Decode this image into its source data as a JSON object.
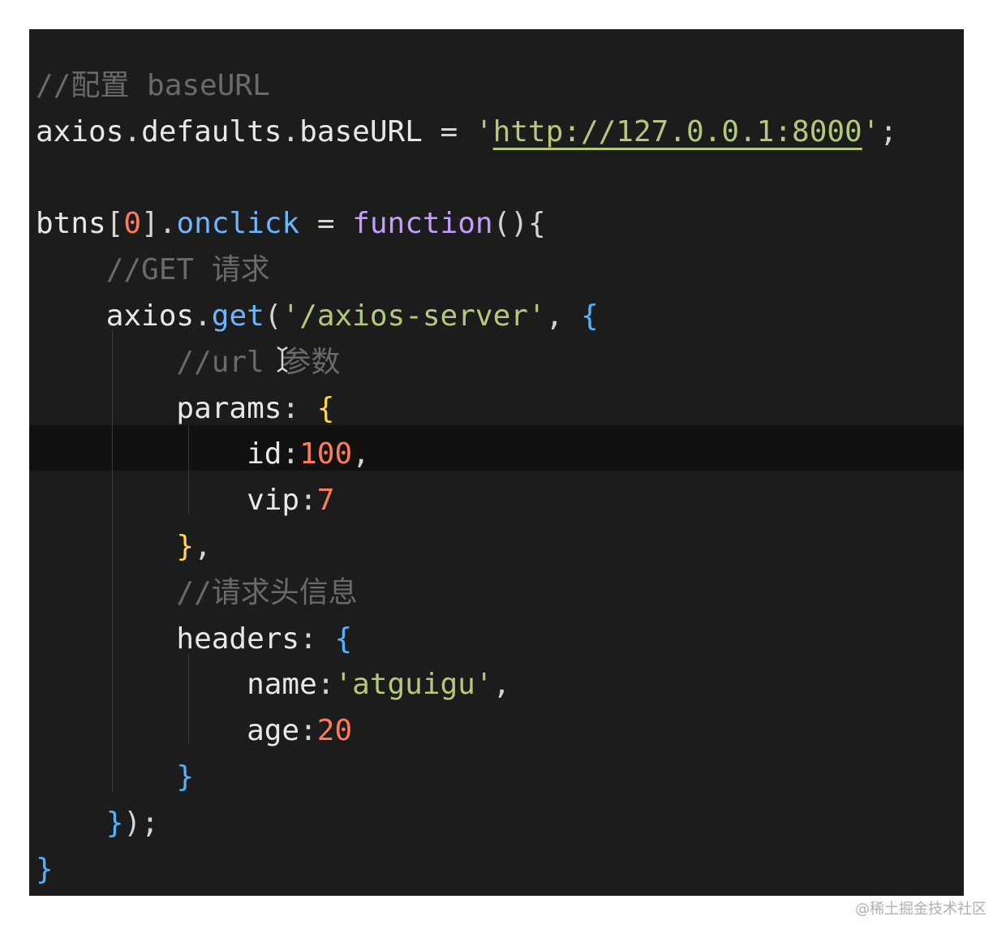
{
  "editor": {
    "lines": [
      {
        "tokens": [
          {
            "cls": "comment",
            "text": "//配置 baseURL"
          }
        ]
      },
      {
        "tokens": [
          {
            "cls": "plain",
            "text": "axios"
          },
          {
            "cls": "punct",
            "text": "."
          },
          {
            "cls": "prop",
            "text": "defaults"
          },
          {
            "cls": "punct",
            "text": "."
          },
          {
            "cls": "prop",
            "text": "baseURL"
          },
          {
            "cls": "op",
            "text": " = "
          },
          {
            "cls": "str",
            "text": "'"
          },
          {
            "cls": "url",
            "text": "http://127.0.0.1:8000"
          },
          {
            "cls": "str",
            "text": "'"
          },
          {
            "cls": "punct",
            "text": ";"
          }
        ]
      },
      {
        "tokens": []
      },
      {
        "tokens": [
          {
            "cls": "plain",
            "text": "btns"
          },
          {
            "cls": "punct",
            "text": "["
          },
          {
            "cls": "num",
            "text": "0"
          },
          {
            "cls": "punct",
            "text": "]."
          },
          {
            "cls": "method",
            "text": "onclick"
          },
          {
            "cls": "op",
            "text": " = "
          },
          {
            "cls": "kw",
            "text": "function"
          },
          {
            "cls": "punct",
            "text": "()"
          },
          {
            "cls": "punct",
            "text": "{"
          }
        ]
      },
      {
        "tokens": [
          {
            "cls": "plain",
            "text": "    "
          },
          {
            "cls": "comment",
            "text": "//GET 请求"
          }
        ]
      },
      {
        "tokens": [
          {
            "cls": "plain",
            "text": "    axios"
          },
          {
            "cls": "punct",
            "text": "."
          },
          {
            "cls": "method",
            "text": "get"
          },
          {
            "cls": "punct",
            "text": "("
          },
          {
            "cls": "str",
            "text": "'/axios-server'"
          },
          {
            "cls": "punct",
            "text": ", "
          },
          {
            "cls": "brace-b",
            "text": "{"
          }
        ]
      },
      {
        "tokens": [
          {
            "cls": "plain",
            "text": "        "
          },
          {
            "cls": "comment",
            "text": "//url 参数"
          }
        ]
      },
      {
        "tokens": [
          {
            "cls": "plain",
            "text": "        params"
          },
          {
            "cls": "punct",
            "text": ": "
          },
          {
            "cls": "brace-y",
            "text": "{"
          }
        ]
      },
      {
        "tokens": [
          {
            "cls": "plain",
            "text": "            id"
          },
          {
            "cls": "punct",
            "text": ":"
          },
          {
            "cls": "num",
            "text": "100"
          },
          {
            "cls": "punct",
            "text": ","
          }
        ]
      },
      {
        "tokens": [
          {
            "cls": "plain",
            "text": "            vip"
          },
          {
            "cls": "punct",
            "text": ":"
          },
          {
            "cls": "num",
            "text": "7"
          }
        ]
      },
      {
        "tokens": [
          {
            "cls": "plain",
            "text": "        "
          },
          {
            "cls": "brace-y",
            "text": "}"
          },
          {
            "cls": "punct",
            "text": ","
          }
        ]
      },
      {
        "tokens": [
          {
            "cls": "plain",
            "text": "        "
          },
          {
            "cls": "comment",
            "text": "//请求头信息"
          }
        ]
      },
      {
        "tokens": [
          {
            "cls": "plain",
            "text": "        headers"
          },
          {
            "cls": "punct",
            "text": ": "
          },
          {
            "cls": "brace-b",
            "text": "{"
          }
        ]
      },
      {
        "tokens": [
          {
            "cls": "plain",
            "text": "            name"
          },
          {
            "cls": "punct",
            "text": ":"
          },
          {
            "cls": "str",
            "text": "'atguigu'"
          },
          {
            "cls": "punct",
            "text": ","
          }
        ]
      },
      {
        "tokens": [
          {
            "cls": "plain",
            "text": "            age"
          },
          {
            "cls": "punct",
            "text": ":"
          },
          {
            "cls": "num",
            "text": "20"
          }
        ]
      },
      {
        "tokens": [
          {
            "cls": "plain",
            "text": "        "
          },
          {
            "cls": "brace-b",
            "text": "}"
          }
        ]
      },
      {
        "tokens": [
          {
            "cls": "plain",
            "text": "    "
          },
          {
            "cls": "brace-b",
            "text": "}"
          },
          {
            "cls": "punct",
            "text": ");"
          }
        ]
      },
      {
        "tokens": [
          {
            "cls": "brace-b",
            "text": "}"
          }
        ]
      }
    ]
  },
  "watermark": "@稀土掘金技术社区",
  "colors": {
    "background": "#1c1c1c",
    "comment": "#6a6a6a",
    "string": "#b5c97a",
    "number": "#ff7b5a",
    "keyword": "#c49cff",
    "method": "#6db5ff"
  },
  "icons": {
    "cursor": "text-cursor-icon"
  }
}
